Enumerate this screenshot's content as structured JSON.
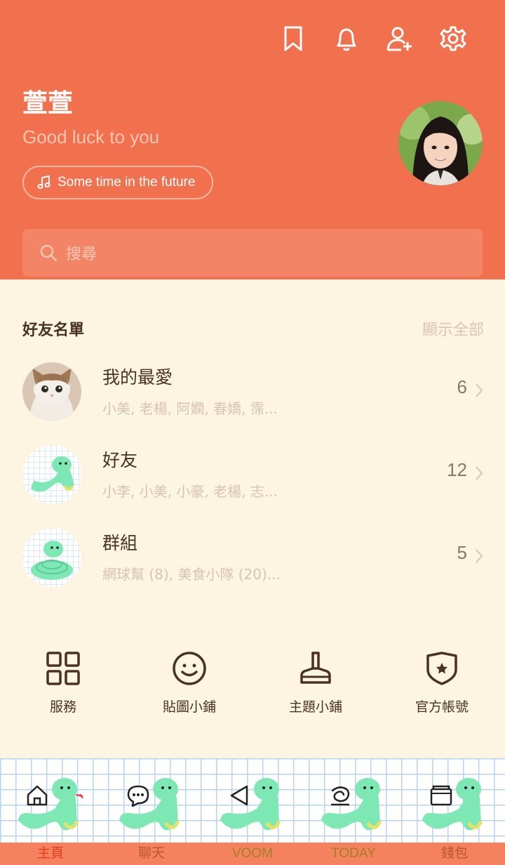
{
  "header": {
    "icons": [
      "bookmark-icon",
      "bell-icon",
      "add-friend-icon",
      "gear-icon"
    ],
    "profile": {
      "name": "萱萱",
      "status": "Good luck to you",
      "music": "Some time in the future"
    },
    "search_placeholder": "搜尋"
  },
  "friends": {
    "title": "好友名單",
    "show_all": "顯示全部",
    "rows": [
      {
        "title": "我的最愛",
        "subtitle": "小美, 老楊, 阿嫻, 春嬌, 霈...",
        "count": "6"
      },
      {
        "title": "好友",
        "subtitle": "小李, 小美, 小豪, 老楊, 志...",
        "count": "12"
      },
      {
        "title": "群組",
        "subtitle": "網球幫 (8), 美食小隊 (20)...",
        "count": "5"
      }
    ]
  },
  "services": [
    {
      "label": "服務",
      "icon": "grid-icon"
    },
    {
      "label": "貼圖小鋪",
      "icon": "smiley-icon"
    },
    {
      "label": "主題小鋪",
      "icon": "brush-icon"
    },
    {
      "label": "官方帳號",
      "icon": "shield-star-icon"
    }
  ],
  "bottom_nav": [
    {
      "label": "主頁",
      "icon": "home-icon",
      "color": "#e83a1f"
    },
    {
      "label": "聊天",
      "icon": "chat-icon",
      "color": "#d96a3a"
    },
    {
      "label": "VOOM",
      "icon": "voom-icon",
      "color": "#c79a2e"
    },
    {
      "label": "TODAY",
      "icon": "today-icon",
      "color": "#c79a2e"
    },
    {
      "label": "錢包",
      "icon": "wallet-icon",
      "color": "#d96a3a"
    }
  ],
  "colors": {
    "header_bg": "#f1714f",
    "body_bg": "#fdf5e2",
    "text_dark": "#4b3122",
    "snake": "#7ee8b5"
  }
}
